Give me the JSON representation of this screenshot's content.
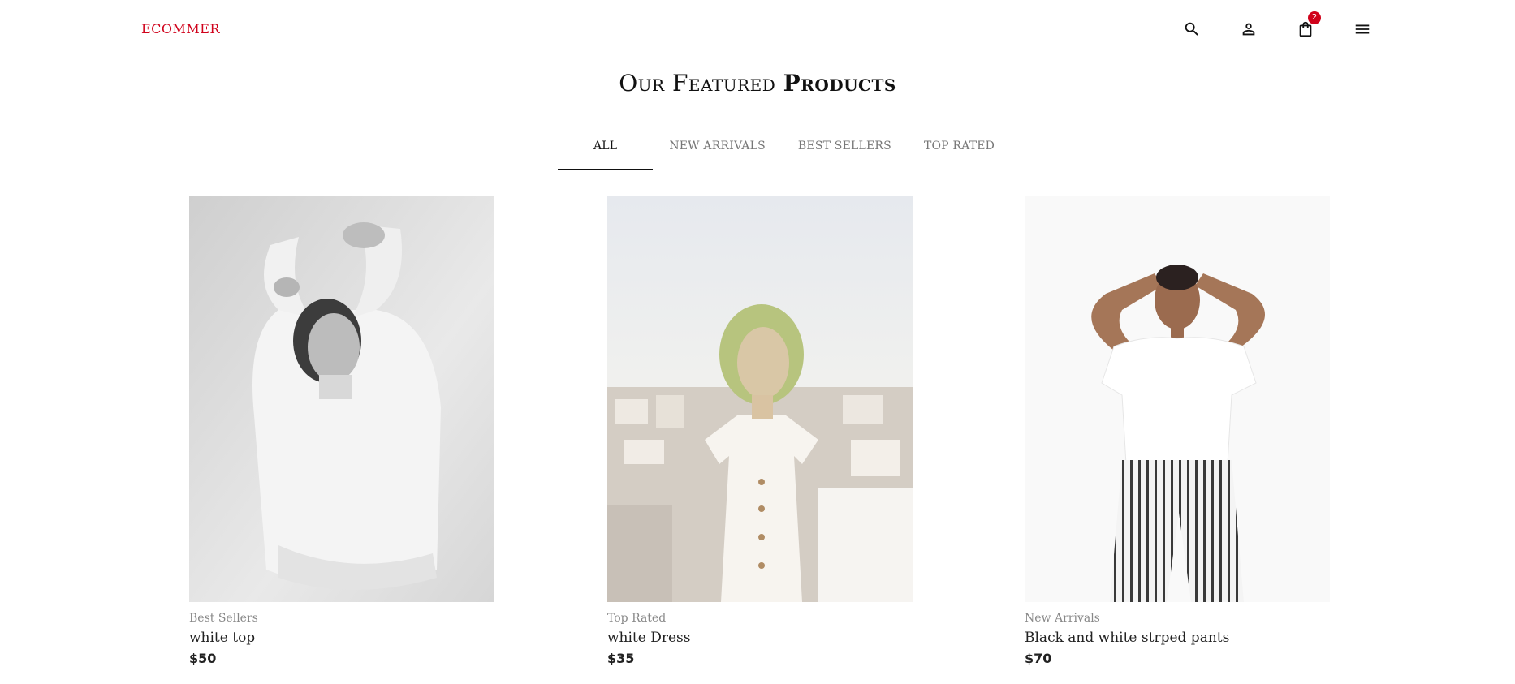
{
  "header": {
    "logo": "ECOMMER",
    "icons": [
      "search-icon",
      "user-icon",
      "shopping-bag-icon",
      "menu-icon"
    ],
    "cart_count": "2",
    "brand_color": "#d0021b"
  },
  "section": {
    "title_light": "Our Featured",
    "title_bold": "Products"
  },
  "tabs": [
    {
      "label": "ALL",
      "active": true
    },
    {
      "label": "NEW ARRIVALS",
      "active": false
    },
    {
      "label": "BEST SELLERS",
      "active": false
    },
    {
      "label": "TOP RATED",
      "active": false
    }
  ],
  "products": [
    {
      "category": "Best Sellers",
      "name": "white top",
      "price": "$50"
    },
    {
      "category": "Top Rated",
      "name": "white Dress",
      "price": "$35"
    },
    {
      "category": "New Arrivals",
      "name": "Black and white strped pants",
      "price": "$70"
    }
  ]
}
